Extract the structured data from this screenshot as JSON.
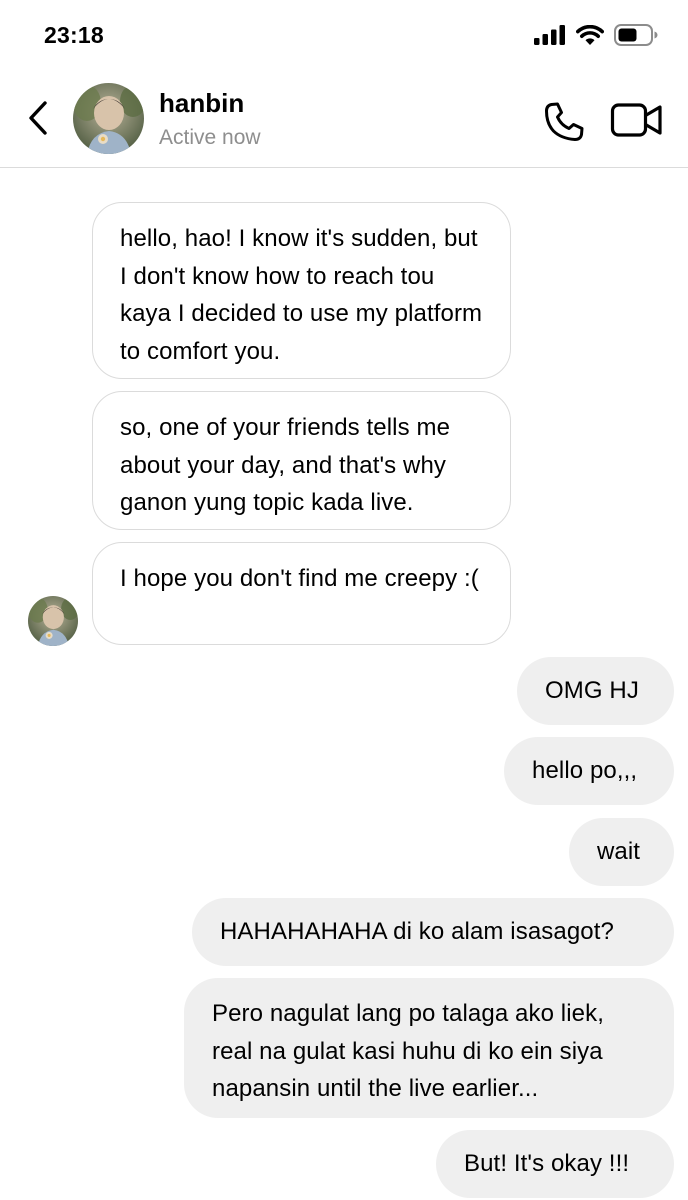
{
  "status_bar": {
    "time": "23:18",
    "icons": [
      "cellular-signal-icon",
      "wifi-icon",
      "battery-icon"
    ]
  },
  "header": {
    "name": "hanbin",
    "status": "Active now",
    "icons": [
      "back-chevron-icon",
      "phone-icon",
      "video-camera-icon"
    ]
  },
  "conversation": {
    "incoming": [
      "hello, hao! I know it's sudden, but I don't know how to reach tou kaya I decided to use my platform to comfort you.",
      "so, one of your friends tells me about your day, and that's why ganon yung topic kada live.",
      "I hope you don't find me creepy :("
    ],
    "outgoing": [
      "OMG HJ",
      "hello po,,,",
      "wait",
      "HAHAHAHAHA di ko alam isasagot?",
      "Pero nagulat lang po talaga ako liek, real na gulat kasi huhu di ko ein siya napansin until the live earlier...",
      "But! It's okay !!!"
    ]
  },
  "colors": {
    "outgoing_bubble": "#efefef",
    "incoming_border": "#dbdbdb",
    "secondary_text": "#8e8e8e"
  }
}
